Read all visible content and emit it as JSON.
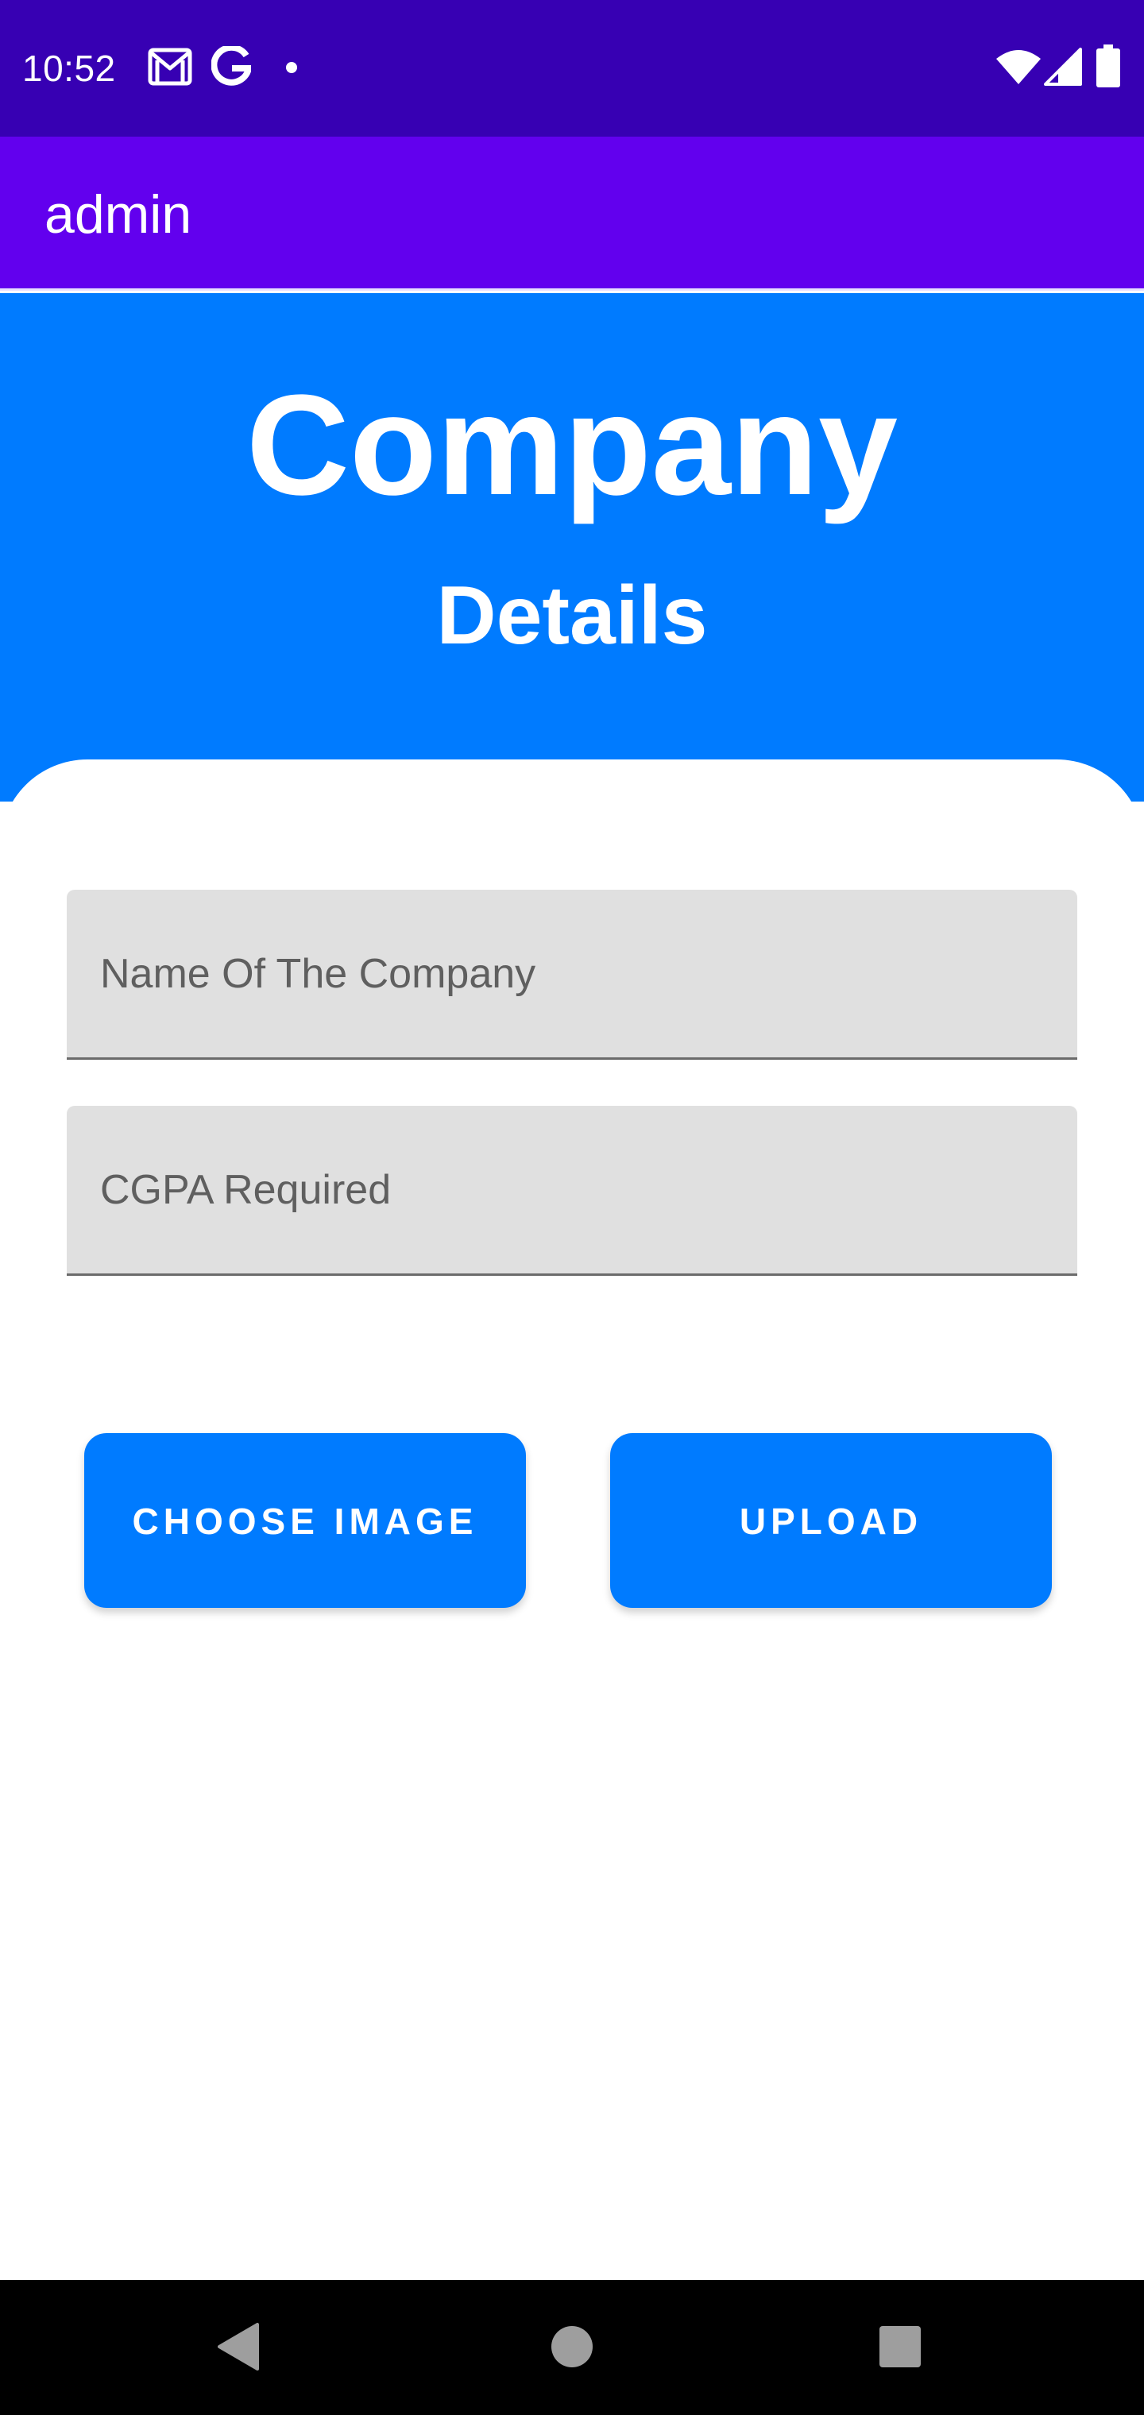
{
  "status_bar": {
    "time": "10:52",
    "icons": [
      "gmail-icon",
      "google-icon",
      "notification-dot-icon",
      "wifi-icon",
      "signal-icon",
      "battery-icon"
    ]
  },
  "app_bar": {
    "title": "admin"
  },
  "header": {
    "title": "Company",
    "subtitle": "Details"
  },
  "form": {
    "company_name": {
      "value": "",
      "placeholder": "Name Of The Company"
    },
    "cgpa": {
      "value": "",
      "placeholder": "CGPA Required"
    },
    "choose_image_label": "CHOOSE IMAGE",
    "upload_label": "UPLOAD"
  },
  "nav_bar": {
    "icons": [
      "back-icon",
      "home-icon",
      "recents-icon"
    ]
  },
  "colors": {
    "status_bar": "#3700b3",
    "app_bar": "#6200ee",
    "primary": "#007bff",
    "input_bg": "#e0e0e0",
    "nav_bar": "#000000"
  }
}
